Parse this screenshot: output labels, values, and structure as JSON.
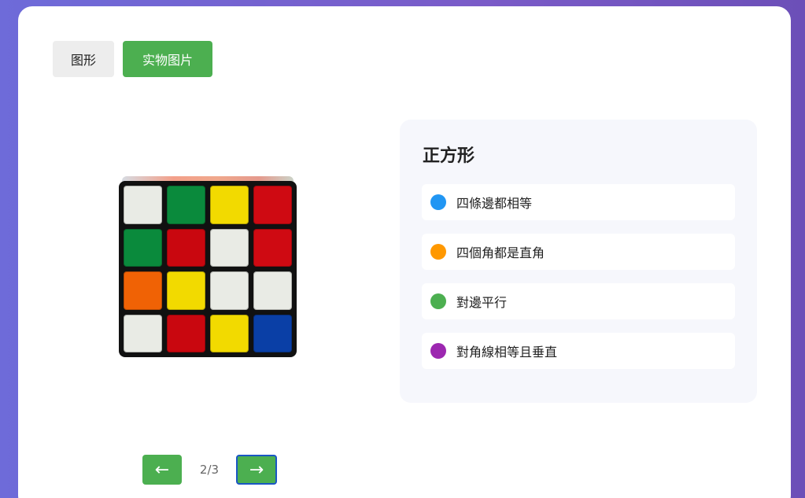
{
  "tabs": {
    "shape_label": "图形",
    "photo_label": "实物图片",
    "active": "photo"
  },
  "cube": {
    "top_edge_colors": [
      "#d6dbe2",
      "#f3a08a",
      "#e59a8d",
      "#cbd3c8"
    ],
    "stickers": [
      "#e9ebe5",
      "#0a8a3c",
      "#f2da00",
      "#cf0a12",
      "#0a8a3c",
      "#c9070f",
      "#e9ebe5",
      "#cf0a12",
      "#f06205",
      "#f2da00",
      "#e9ebe5",
      "#e9ebe5",
      "#e9ebe5",
      "#c9070f",
      "#f2da00",
      "#0a3fa6"
    ]
  },
  "info": {
    "title": "正方形",
    "properties": [
      {
        "text": "四條邊都相等",
        "color": "#2196f3"
      },
      {
        "text": "四個角都是直角",
        "color": "#ff9800"
      },
      {
        "text": "對邊平行",
        "color": "#4caf50"
      },
      {
        "text": "對角線相等且垂直",
        "color": "#9c27b0"
      }
    ]
  },
  "pager": {
    "prev_label": "←",
    "next_label": "→",
    "counter": "2/3"
  }
}
